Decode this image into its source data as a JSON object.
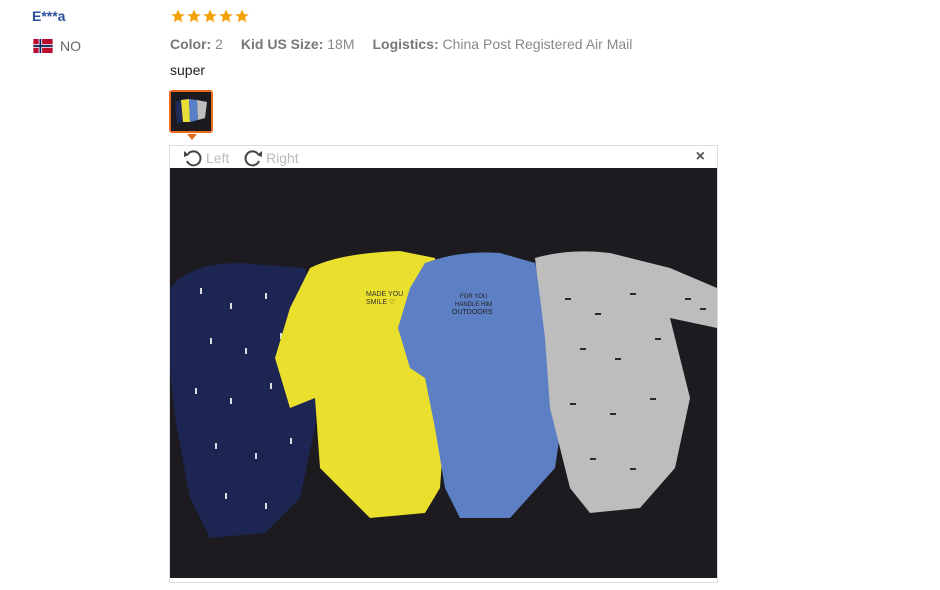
{
  "reviewer": {
    "name": "E***a",
    "country_code": "NO"
  },
  "review": {
    "rating": 5,
    "star_color": "#f5a20a",
    "attributes": [
      {
        "label": "Color:",
        "value": "2"
      },
      {
        "label": "Kid US Size:",
        "value": "18M"
      },
      {
        "label": "Logistics:",
        "value": "China Post Registered Air Mail"
      }
    ],
    "text": "super"
  },
  "viewer": {
    "rotate_left_label": "Left",
    "rotate_right_label": "Right",
    "close_label": "×"
  },
  "photo": {
    "description_items": [
      {
        "label": "MADE YOU SMILE"
      },
      {
        "label": "FOR YOU HANDLE HIM OUTDOORS"
      }
    ]
  }
}
